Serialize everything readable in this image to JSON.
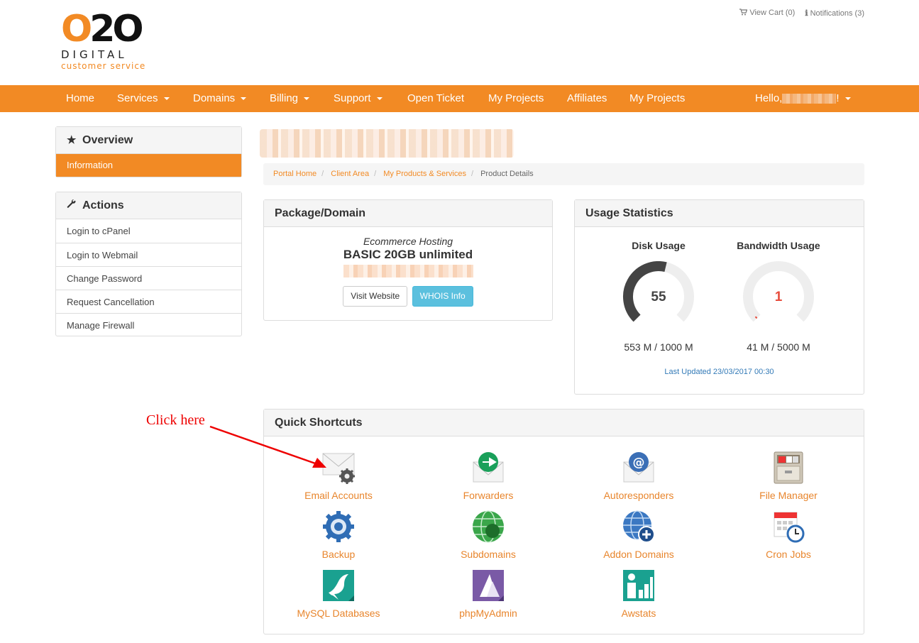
{
  "logo": {
    "brand_o": "O",
    "brand_rest": "2O",
    "line2": "DIGITAL",
    "line3": "customer service"
  },
  "toplinks": {
    "cart": "View Cart (0)",
    "notifications": "Notifications (3)"
  },
  "nav": {
    "items": [
      {
        "label": "Home"
      },
      {
        "label": "Services"
      },
      {
        "label": "Domains"
      },
      {
        "label": "Billing"
      },
      {
        "label": "Support"
      },
      {
        "label": "Open Ticket"
      },
      {
        "label": "My Projects"
      },
      {
        "label": "Affiliates"
      },
      {
        "label": "My Projects"
      }
    ],
    "hello_prefix": "Hello,",
    "hello_suffix": "!"
  },
  "sidebar": {
    "overview": {
      "title": "Overview",
      "active_item": "Information"
    },
    "actions": {
      "title": "Actions",
      "items": [
        "Login to cPanel",
        "Login to Webmail",
        "Change Password",
        "Request Cancellation",
        "Manage Firewall"
      ]
    }
  },
  "breadcrumb": {
    "items": [
      "Portal Home",
      "Client Area",
      "My Products & Services"
    ],
    "current": "Product Details"
  },
  "package": {
    "title": "Package/Domain",
    "type": "Ecommerce Hosting",
    "name": "BASIC 20GB unlimited",
    "visit_button": "Visit Website",
    "whois_button": "WHOIS Info"
  },
  "usage": {
    "title": "Usage Statistics",
    "disk": {
      "title": "Disk Usage",
      "percent": 55,
      "value_label": "55",
      "caption": "553 M / 1000 M"
    },
    "bandwidth": {
      "title": "Bandwidth Usage",
      "percent": 1,
      "value_label": "1",
      "caption": "41 M / 5000 M"
    },
    "last_updated": "Last Updated 23/03/2017 00:30"
  },
  "shortcuts": {
    "title": "Quick Shortcuts",
    "items": [
      {
        "label": "Email Accounts",
        "icon": "email-accounts-icon"
      },
      {
        "label": "Forwarders",
        "icon": "forwarders-icon"
      },
      {
        "label": "Autoresponders",
        "icon": "autoresponders-icon"
      },
      {
        "label": "File Manager",
        "icon": "file-manager-icon"
      },
      {
        "label": "Backup",
        "icon": "backup-icon"
      },
      {
        "label": "Subdomains",
        "icon": "subdomains-icon"
      },
      {
        "label": "Addon Domains",
        "icon": "addon-domains-icon"
      },
      {
        "label": "Cron Jobs",
        "icon": "cron-jobs-icon"
      },
      {
        "label": "MySQL Databases",
        "icon": "mysql-icon"
      },
      {
        "label": "phpMyAdmin",
        "icon": "phpmyadmin-icon"
      },
      {
        "label": "Awstats",
        "icon": "awstats-icon"
      }
    ]
  },
  "annotation": {
    "text": "Click here"
  },
  "colors": {
    "brand": "#f28a24",
    "info": "#5bc0de",
    "gauge_dark": "#444444",
    "gauge_light": "#eeeeee",
    "gauge_low": "#e74c3c"
  }
}
